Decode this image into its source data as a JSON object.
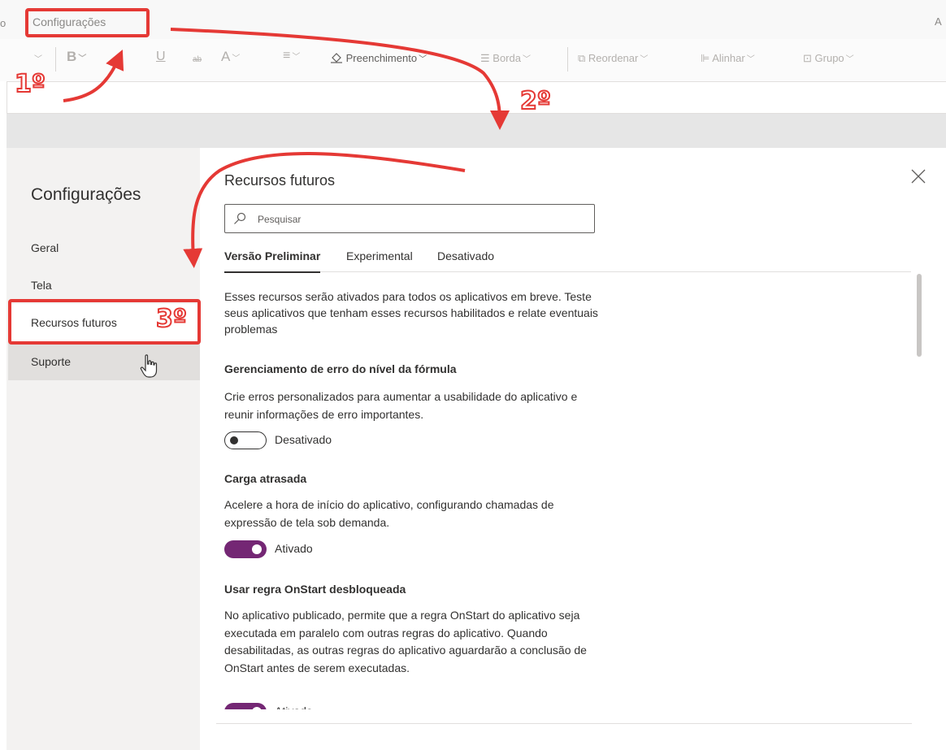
{
  "menubar": {
    "left_cut": "o",
    "settings_label": "Configurações",
    "right_cut": "A"
  },
  "ribbon": {
    "bold": "B",
    "underline": "U",
    "strike": "ab",
    "font_size": "A",
    "fill": "Preenchimento",
    "border": "Borda",
    "reorder": "Reordenar",
    "align": "Alinhar",
    "group": "Grupo"
  },
  "nav": {
    "title": "Configurações",
    "items": [
      {
        "label": "Geral"
      },
      {
        "label": "Tela"
      },
      {
        "label": "Recursos futuros"
      },
      {
        "label": "Suporte"
      }
    ]
  },
  "panel": {
    "title": "Recursos futuros",
    "search_placeholder": "Pesquisar",
    "tabs": [
      {
        "label": "Versão Preliminar"
      },
      {
        "label": "Experimental"
      },
      {
        "label": "Desativado"
      }
    ],
    "intro": "Esses recursos serão ativados para todos os aplicativos em breve. Teste seus aplicativos que tenham esses recursos habilitados e relate eventuais problemas",
    "features": [
      {
        "title": "Gerenciamento de erro do nível da fórmula",
        "description": "Crie erros personalizados para aumentar a usabilidade do aplicativo e reunir informações de erro importantes.",
        "state": "Desativado",
        "enabled": false
      },
      {
        "title": "Carga atrasada",
        "description": "Acelere a hora de início do aplicativo, configurando chamadas de expressão de tela sob demanda.",
        "state": "Ativado",
        "enabled": true
      },
      {
        "title": "Usar regra OnStart desbloqueada",
        "description": "No aplicativo publicado, permite que a regra OnStart do aplicativo seja executada em paralelo com outras regras do aplicativo. Quando desabilitadas, as outras regras do aplicativo aguardarão a conclusão de OnStart antes de serem executadas.",
        "state": "Ativado",
        "enabled": true
      }
    ]
  },
  "annotations": {
    "step1": "1º",
    "step2": "2º",
    "step3": "3º"
  },
  "colors": {
    "toggle_on": "#742774",
    "annotation": "#e53935"
  }
}
